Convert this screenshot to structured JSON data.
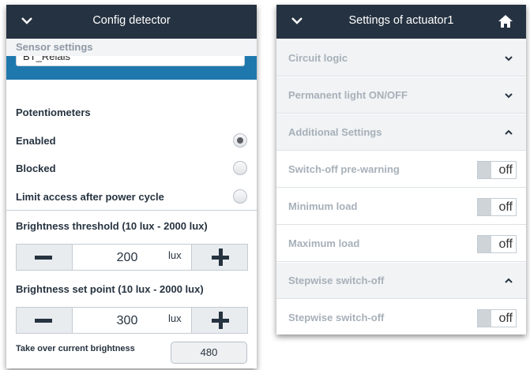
{
  "left": {
    "title": "Config detector",
    "name_value": "BT_Relais",
    "sensor_settings": "Sensor settings",
    "potentiometers": "Potentiometers",
    "options": [
      {
        "label": "Enabled",
        "selected": true
      },
      {
        "label": "Blocked",
        "selected": false
      },
      {
        "label": "Limit access after power cycle",
        "selected": false
      }
    ],
    "threshold": {
      "label": "Brightness threshold (10 lux - 2000 lux)",
      "value": "200",
      "unit": "lux"
    },
    "setpoint": {
      "label": "Brightness set point (10 lux - 2000 lux)",
      "value": "300",
      "unit": "lux"
    },
    "take_over": {
      "label": "Take over current brightness",
      "value": "480"
    }
  },
  "right": {
    "title": "Settings of actuator1",
    "sections": [
      {
        "label": "Circuit logic",
        "type": "section",
        "expanded": false
      },
      {
        "label": "Permanent light ON/OFF",
        "type": "section",
        "expanded": false
      },
      {
        "label": "Additional Settings",
        "type": "section",
        "expanded": true
      },
      {
        "label": "Switch-off pre-warning",
        "type": "toggle",
        "value": "off"
      },
      {
        "label": "Minimum load",
        "type": "toggle",
        "value": "off"
      },
      {
        "label": "Maximum load",
        "type": "toggle",
        "value": "off"
      },
      {
        "label": "Stepwise switch-off",
        "type": "section",
        "expanded": true
      },
      {
        "label": "Stepwise switch-off",
        "type": "toggle",
        "value": "off"
      }
    ]
  },
  "colors": {
    "header": "#253241",
    "accent": "#1f78ad",
    "text": "#263340",
    "muted": "#a7b0b9"
  }
}
